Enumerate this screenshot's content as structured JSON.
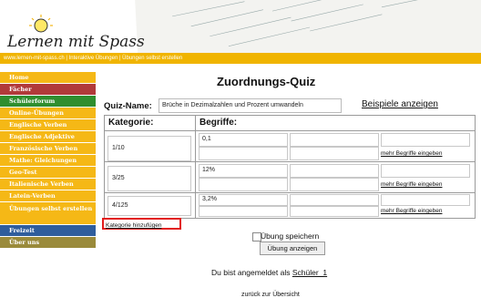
{
  "header": {
    "logo": "Lernen mit Spass"
  },
  "topbar": {
    "text": "www.lernen-mit-spass.ch | Interaktive Übungen | Übungen selbst erstellen"
  },
  "sidebar": {
    "items": [
      {
        "label": "Home",
        "color": "#f5b816"
      },
      {
        "label": "Fächer",
        "color": "#b13a3a"
      },
      {
        "label": "Schülerforum",
        "color": "#2f8e2f"
      },
      {
        "label": "Online-Übungen",
        "color": "#f5b816"
      },
      {
        "label": "Englische Verben",
        "color": "#f5b816"
      },
      {
        "label": "Englische Adjektive",
        "color": "#f5b816"
      },
      {
        "label": "Französische Verben",
        "color": "#f5b816"
      },
      {
        "label": "Mathe: Gleichungen",
        "color": "#f5b816"
      },
      {
        "label": "Geo-Test",
        "color": "#f5b816"
      },
      {
        "label": "Italienische Verben",
        "color": "#f5b816"
      },
      {
        "label": "Latein-Verben",
        "color": "#f5b816"
      },
      {
        "label": "Übungen selbst erstellen",
        "color": "#f5b816"
      },
      {
        "label": "Freizeit",
        "color": "#2f5d9c"
      },
      {
        "label": "Über uns",
        "color": "#9a8a3a"
      }
    ]
  },
  "main": {
    "title": "Zuordnungs-Quiz",
    "quiz_label": "Quiz-Name:",
    "quiz_value": "Brüche in Dezimalzahlen und Prozent umwandeln",
    "example_link": "Beispiele anzeigen",
    "col_category": "Kategorie:",
    "col_terms": "Begriffe:",
    "rows": [
      {
        "category": "1/10",
        "term": "0,1",
        "more": "mehr Begriffe eingeben"
      },
      {
        "category": "3/25",
        "term": "12%",
        "more": "mehr Begriffe eingeben"
      },
      {
        "category": "4/125",
        "term": "3,2%",
        "more": "mehr Begriffe eingeben"
      }
    ],
    "add_category": "Kategorie hinzufügen",
    "save_label": "Übung speichern",
    "show_button": "Übung anzeigen",
    "logged_prefix": "Du bist angemeldet als",
    "logged_user": "Schüler_1",
    "back_link": "zurück zur Übersicht"
  }
}
